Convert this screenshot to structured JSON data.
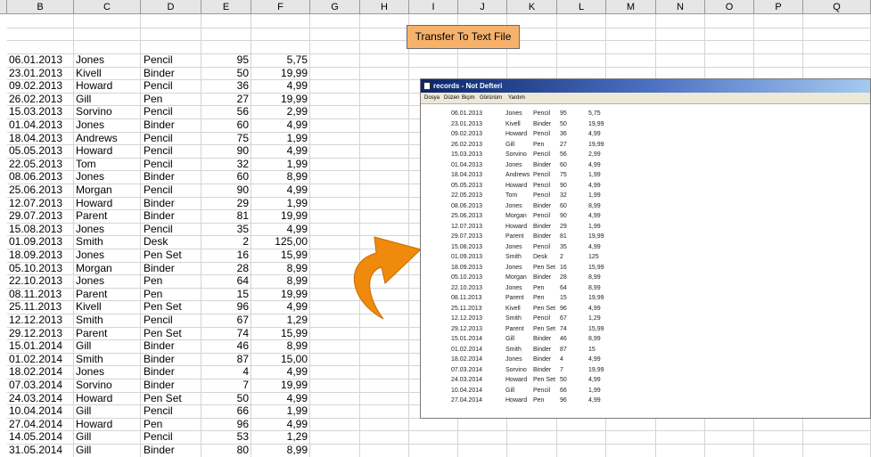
{
  "columns": [
    "B",
    "C",
    "D",
    "E",
    "F",
    "G",
    "H",
    "I",
    "J",
    "K",
    "L",
    "M",
    "N",
    "O",
    "P",
    "Q"
  ],
  "button": {
    "label": "Transfer To Text File"
  },
  "rows": [
    [
      "06.01.2013",
      "Jones",
      "Pencil",
      "95",
      "5,75"
    ],
    [
      "23.01.2013",
      "Kivell",
      "Binder",
      "50",
      "19,99"
    ],
    [
      "09.02.2013",
      "Howard",
      "Pencil",
      "36",
      "4,99"
    ],
    [
      "26.02.2013",
      "Gill",
      "Pen",
      "27",
      "19,99"
    ],
    [
      "15.03.2013",
      "Sorvino",
      "Pencil",
      "56",
      "2,99"
    ],
    [
      "01.04.2013",
      "Jones",
      "Binder",
      "60",
      "4,99"
    ],
    [
      "18.04.2013",
      "Andrews",
      "Pencil",
      "75",
      "1,99"
    ],
    [
      "05.05.2013",
      "Howard",
      "Pencil",
      "90",
      "4,99"
    ],
    [
      "22.05.2013",
      "Tom",
      "Pencil",
      "32",
      "1,99"
    ],
    [
      "08.06.2013",
      "Jones",
      "Binder",
      "60",
      "8,99"
    ],
    [
      "25.06.2013",
      "Morgan",
      "Pencil",
      "90",
      "4,99"
    ],
    [
      "12.07.2013",
      "Howard",
      "Binder",
      "29",
      "1,99"
    ],
    [
      "29.07.2013",
      "Parent",
      "Binder",
      "81",
      "19,99"
    ],
    [
      "15.08.2013",
      "Jones",
      "Pencil",
      "35",
      "4,99"
    ],
    [
      "01.09.2013",
      "Smith",
      "Desk",
      "2",
      "125,00"
    ],
    [
      "18.09.2013",
      "Jones",
      "Pen Set",
      "16",
      "15,99"
    ],
    [
      "05.10.2013",
      "Morgan",
      "Binder",
      "28",
      "8,99"
    ],
    [
      "22.10.2013",
      "Jones",
      "Pen",
      "64",
      "8,99"
    ],
    [
      "08.11.2013",
      "Parent",
      "Pen",
      "15",
      "19,99"
    ],
    [
      "25.11.2013",
      "Kivell",
      "Pen Set",
      "96",
      "4,99"
    ],
    [
      "12.12.2013",
      "Smith",
      "Pencil",
      "67",
      "1,29"
    ],
    [
      "29.12.2013",
      "Parent",
      "Pen Set",
      "74",
      "15,99"
    ],
    [
      "15.01.2014",
      "Gill",
      "Binder",
      "46",
      "8,99"
    ],
    [
      "01.02.2014",
      "Smith",
      "Binder",
      "87",
      "15,00"
    ],
    [
      "18.02.2014",
      "Jones",
      "Binder",
      "4",
      "4,99"
    ],
    [
      "07.03.2014",
      "Sorvino",
      "Binder",
      "7",
      "19,99"
    ],
    [
      "24.03.2014",
      "Howard",
      "Pen Set",
      "50",
      "4,99"
    ],
    [
      "10.04.2014",
      "Gill",
      "Pencil",
      "66",
      "1,99"
    ],
    [
      "27.04.2014",
      "Howard",
      "Pen",
      "96",
      "4,99"
    ],
    [
      "14.05.2014",
      "Gill",
      "Pencil",
      "53",
      "1,29"
    ],
    [
      "31.05.2014",
      "Gill",
      "Binder",
      "80",
      "8,99"
    ]
  ],
  "notepad": {
    "title": "records - Not Defteri",
    "menu": [
      "Dosya",
      "Düzen",
      "Biçim",
      "Görünüm",
      "Yardım"
    ],
    "lines": [
      [
        "06.01.2013",
        "Jones",
        "Pencil",
        "95",
        "5,75"
      ],
      [
        "23.01.2013",
        "Kivell",
        "Binder",
        "50",
        "19,99"
      ],
      [
        "09.02.2013",
        "Howard",
        "Pencil",
        "36",
        "4,99"
      ],
      [
        "26.02.2013",
        "Gill",
        "Pen",
        "27",
        "19,99"
      ],
      [
        "15.03.2013",
        "Sorvino",
        "Pencil",
        "56",
        "2,99"
      ],
      [
        "01.04.2013",
        "Jones",
        "Binder",
        "60",
        "4,99"
      ],
      [
        "18.04.2013",
        "Andrews",
        "Pencil",
        "75",
        "1,99"
      ],
      [
        "05.05.2013",
        "Howard",
        "Pencil",
        "90",
        "4,99"
      ],
      [
        "22.05.2013",
        "Tom",
        "Pencil",
        "32",
        "1,99"
      ],
      [
        "08.06.2013",
        "Jones",
        "Binder",
        "60",
        "8,99"
      ],
      [
        "25.06.2013",
        "Morgan",
        "Pencil",
        "90",
        "4,99"
      ],
      [
        "12.07.2013",
        "Howard",
        "Binder",
        "29",
        "1,99"
      ],
      [
        "29.07.2013",
        "Parent",
        "Binder",
        "81",
        "19,99"
      ],
      [
        "15.08.2013",
        "Jones",
        "Pencil",
        "35",
        "4,99"
      ],
      [
        "01.09.2013",
        "Smith",
        "Desk",
        "2",
        "125"
      ],
      [
        "18.09.2013",
        "Jones",
        "Pen Set",
        "16",
        "15,99"
      ],
      [
        "05.10.2013",
        "Morgan",
        "Binder",
        "28",
        "8,99"
      ],
      [
        "22.10.2013",
        "Jones",
        "Pen",
        "64",
        "8,99"
      ],
      [
        "08.11.2013",
        "Parent",
        "Pen",
        "15",
        "19,99"
      ],
      [
        "25.11.2013",
        "Kivell",
        "Pen Set",
        "96",
        "4,99"
      ],
      [
        "12.12.2013",
        "Smith",
        "Pencil",
        "67",
        "1,29"
      ],
      [
        "29.12.2013",
        "Parent",
        "Pen Set",
        "74",
        "15,99"
      ],
      [
        "15.01.2014",
        "Gill",
        "Binder",
        "46",
        "8,99"
      ],
      [
        "01.02.2014",
        "Smith",
        "Binder",
        "87",
        "15"
      ],
      [
        "18.02.2014",
        "Jones",
        "Binder",
        "4",
        "4,99"
      ],
      [
        "07.03.2014",
        "Sorvino",
        "Binder",
        "7",
        "19,99"
      ],
      [
        "24.03.2014",
        "Howard",
        "Pen Set",
        "50",
        "4,99"
      ],
      [
        "10.04.2014",
        "Gill",
        "Pencil",
        "66",
        "1,99"
      ],
      [
        "27.04.2014",
        "Howard",
        "Pen",
        "96",
        "4,99"
      ]
    ]
  },
  "arrow_icon": "curved-arrow-icon",
  "colors": {
    "button": "#f6b26b",
    "arrow": "#f08a0c",
    "header": "#e6e6e6",
    "titlebar": "#0a246a"
  }
}
